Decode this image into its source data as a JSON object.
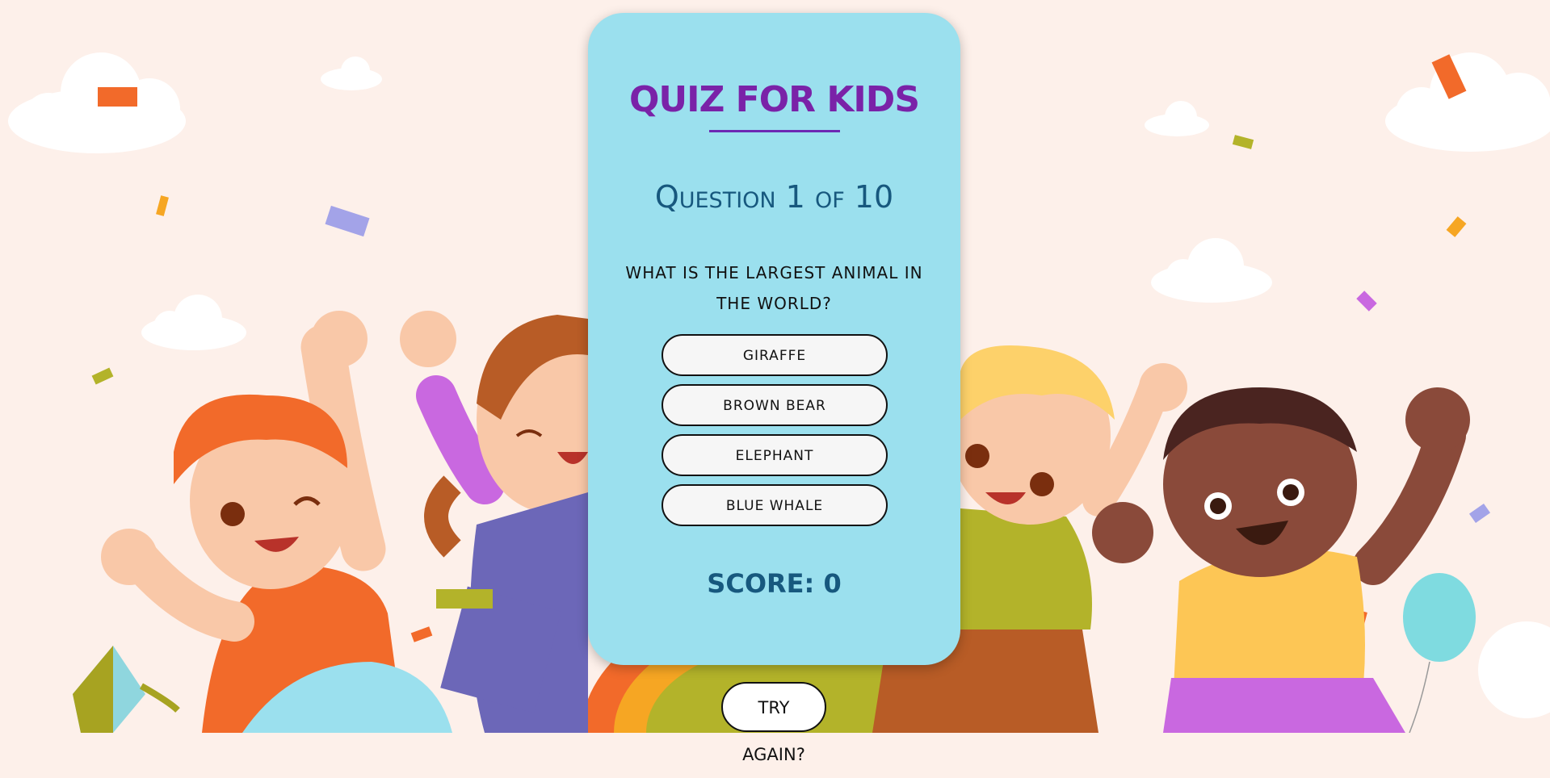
{
  "quiz": {
    "title": "QUIZ FOR KIDS",
    "question_counter": "Question 1 of 10",
    "question_text": "WHAT IS THE LARGEST ANIMAL IN THE WORLD?",
    "answers": [
      "GIRAFFE",
      "BROWN BEAR",
      "ELEPHANT",
      "BLUE WHALE"
    ],
    "score_label": "SCORE: 0",
    "try_again_label": "TRY AGAIN?"
  },
  "colors": {
    "background": "#fdf0ea",
    "card": "#9be0ee",
    "title": "#7a22a8",
    "heading": "#17587e"
  },
  "background_illustration": "cartoon-kids-jumping-with-confetti"
}
